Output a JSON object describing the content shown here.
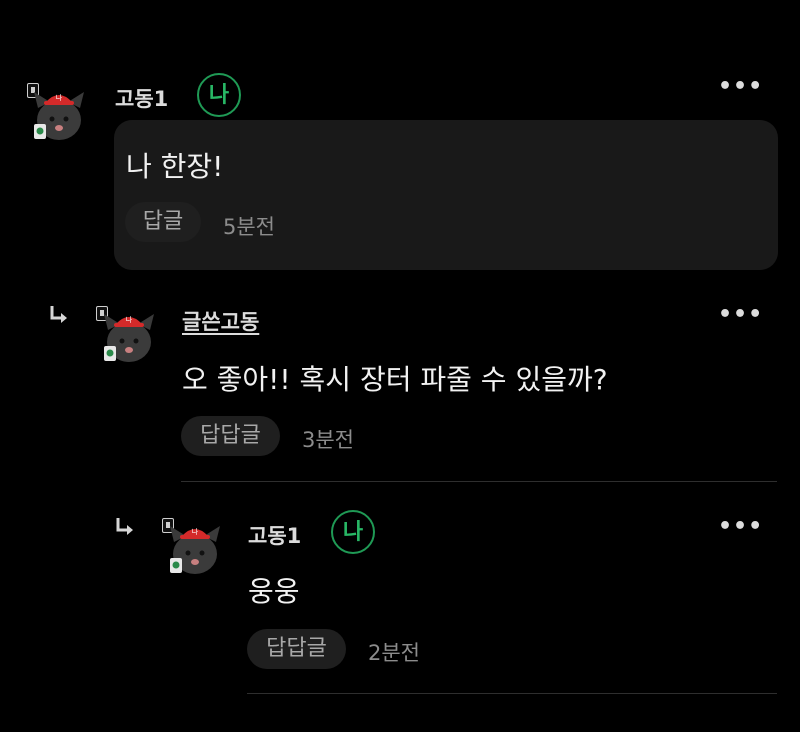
{
  "comments": [
    {
      "author": "고동1",
      "me_badge": "나",
      "text": "나 한장!",
      "reply_label": "답글",
      "time": "5분전"
    },
    {
      "author": "글쓴고동",
      "text": "오 좋아!! 혹시 장터 파줄 수 있을까?",
      "reply_label": "답답글",
      "time": "3분전"
    },
    {
      "author": "고동1",
      "me_badge": "나",
      "text": "웅웅",
      "reply_label": "답답글",
      "time": "2분전"
    }
  ],
  "more_icon": "more-horizontal-icon",
  "colors": {
    "background": "#000000",
    "bubble": "#191919",
    "me_badge": "#28b765"
  }
}
